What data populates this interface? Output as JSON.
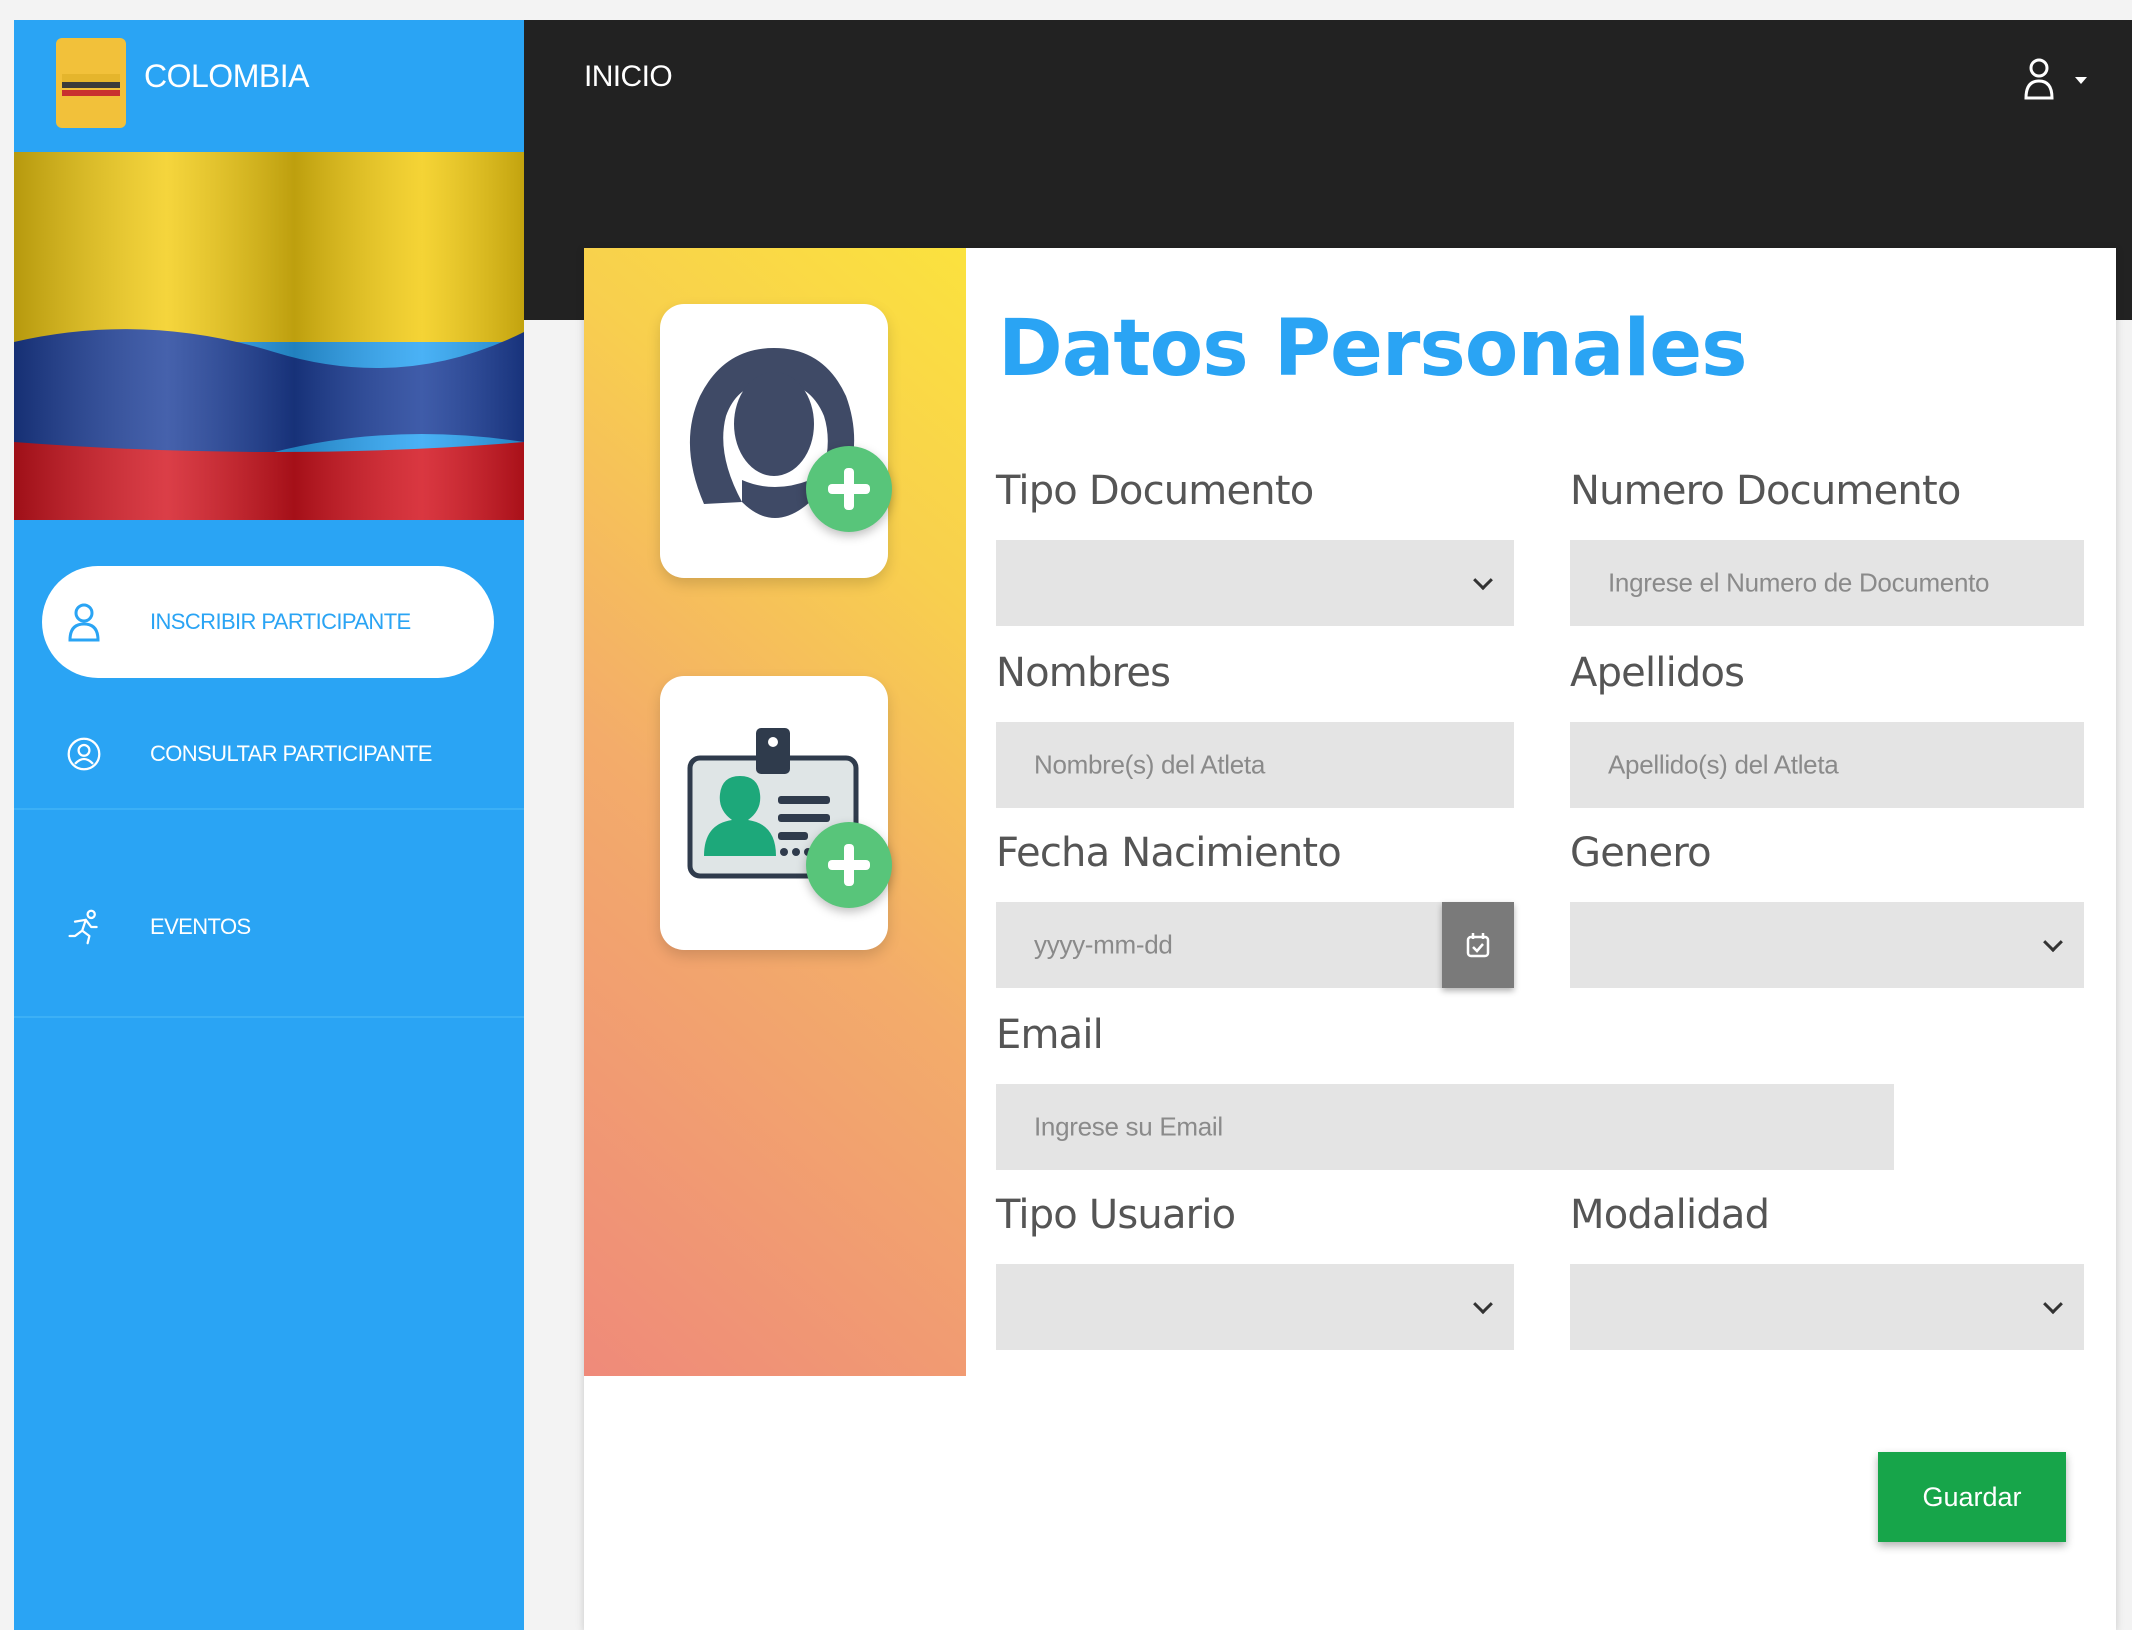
{
  "brand": {
    "name": "COLOMBIA"
  },
  "topbar": {
    "title": "INICIO",
    "user_icon": "user-icon",
    "caret_icon": "caret-down-icon"
  },
  "sidebar": {
    "items": [
      {
        "label": "INSCRIBIR PARTICIPANTE",
        "icon": "user-icon",
        "active": true
      },
      {
        "label": "CONSULTAR PARTICIPANTE",
        "icon": "user-circle-icon",
        "active": false
      },
      {
        "label": "EVENTOS",
        "icon": "runner-icon",
        "active": false
      }
    ]
  },
  "form": {
    "title": "Datos Personales",
    "tipo_documento": {
      "label": "Tipo Documento",
      "value": ""
    },
    "numero_documento": {
      "label": "Numero Documento",
      "placeholder": "Ingrese el Numero de Documento"
    },
    "nombres": {
      "label": "Nombres",
      "placeholder": "Nombre(s) del Atleta"
    },
    "apellidos": {
      "label": "Apellidos",
      "placeholder": "Apellido(s) del Atleta"
    },
    "fecha_nacimiento": {
      "label": "Fecha Nacimiento",
      "placeholder": "yyyy-mm-dd"
    },
    "genero": {
      "label": "Genero",
      "value": ""
    },
    "email": {
      "label": "Email",
      "placeholder": "Ingrese su Email"
    },
    "tipo_usuario": {
      "label": "Tipo Usuario",
      "value": ""
    },
    "modalidad": {
      "label": "Modalidad",
      "value": ""
    },
    "save_label": "Guardar"
  },
  "colors": {
    "sidebar": "#2aa4f4",
    "topbar": "#222222",
    "title": "#2aa4f4",
    "save_button": "#17a54a",
    "add_badge": "#58c57a"
  }
}
